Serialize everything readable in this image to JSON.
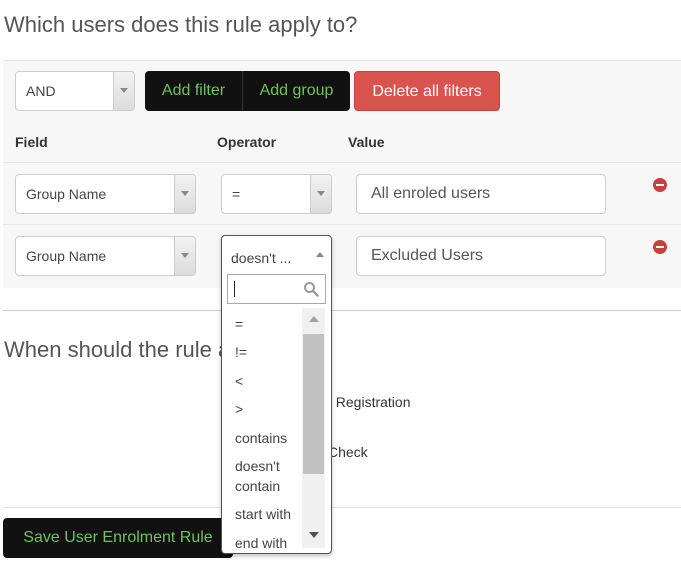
{
  "headings": {
    "users": "Which users does this rule apply to?",
    "when": "When should the rule a"
  },
  "builder": {
    "condition": "AND",
    "add_filter": "Add filter",
    "add_group": "Add group",
    "delete_all": "Delete all filters",
    "columns": {
      "field": "Field",
      "operator": "Operator",
      "value": "Value"
    },
    "rows": [
      {
        "field": "Group Name",
        "operator": "=",
        "value": "All enroled users"
      },
      {
        "field": "Group Name",
        "operator": "doesn't ...",
        "value": "Excluded Users"
      }
    ]
  },
  "dropdown": {
    "selected": "doesn't ...",
    "search_value": "",
    "options": [
      "=",
      "!=",
      "<",
      ">",
      "contains",
      "doesn't contain",
      "start with",
      "end with"
    ]
  },
  "partial_labels": {
    "registration": "f Registration",
    "check": "Check"
  },
  "save_button": "Save User Enrolment Rule",
  "colors": {
    "accent_green": "#6ec35f",
    "danger_red": "#d9534f",
    "dark_button": "#111111"
  }
}
